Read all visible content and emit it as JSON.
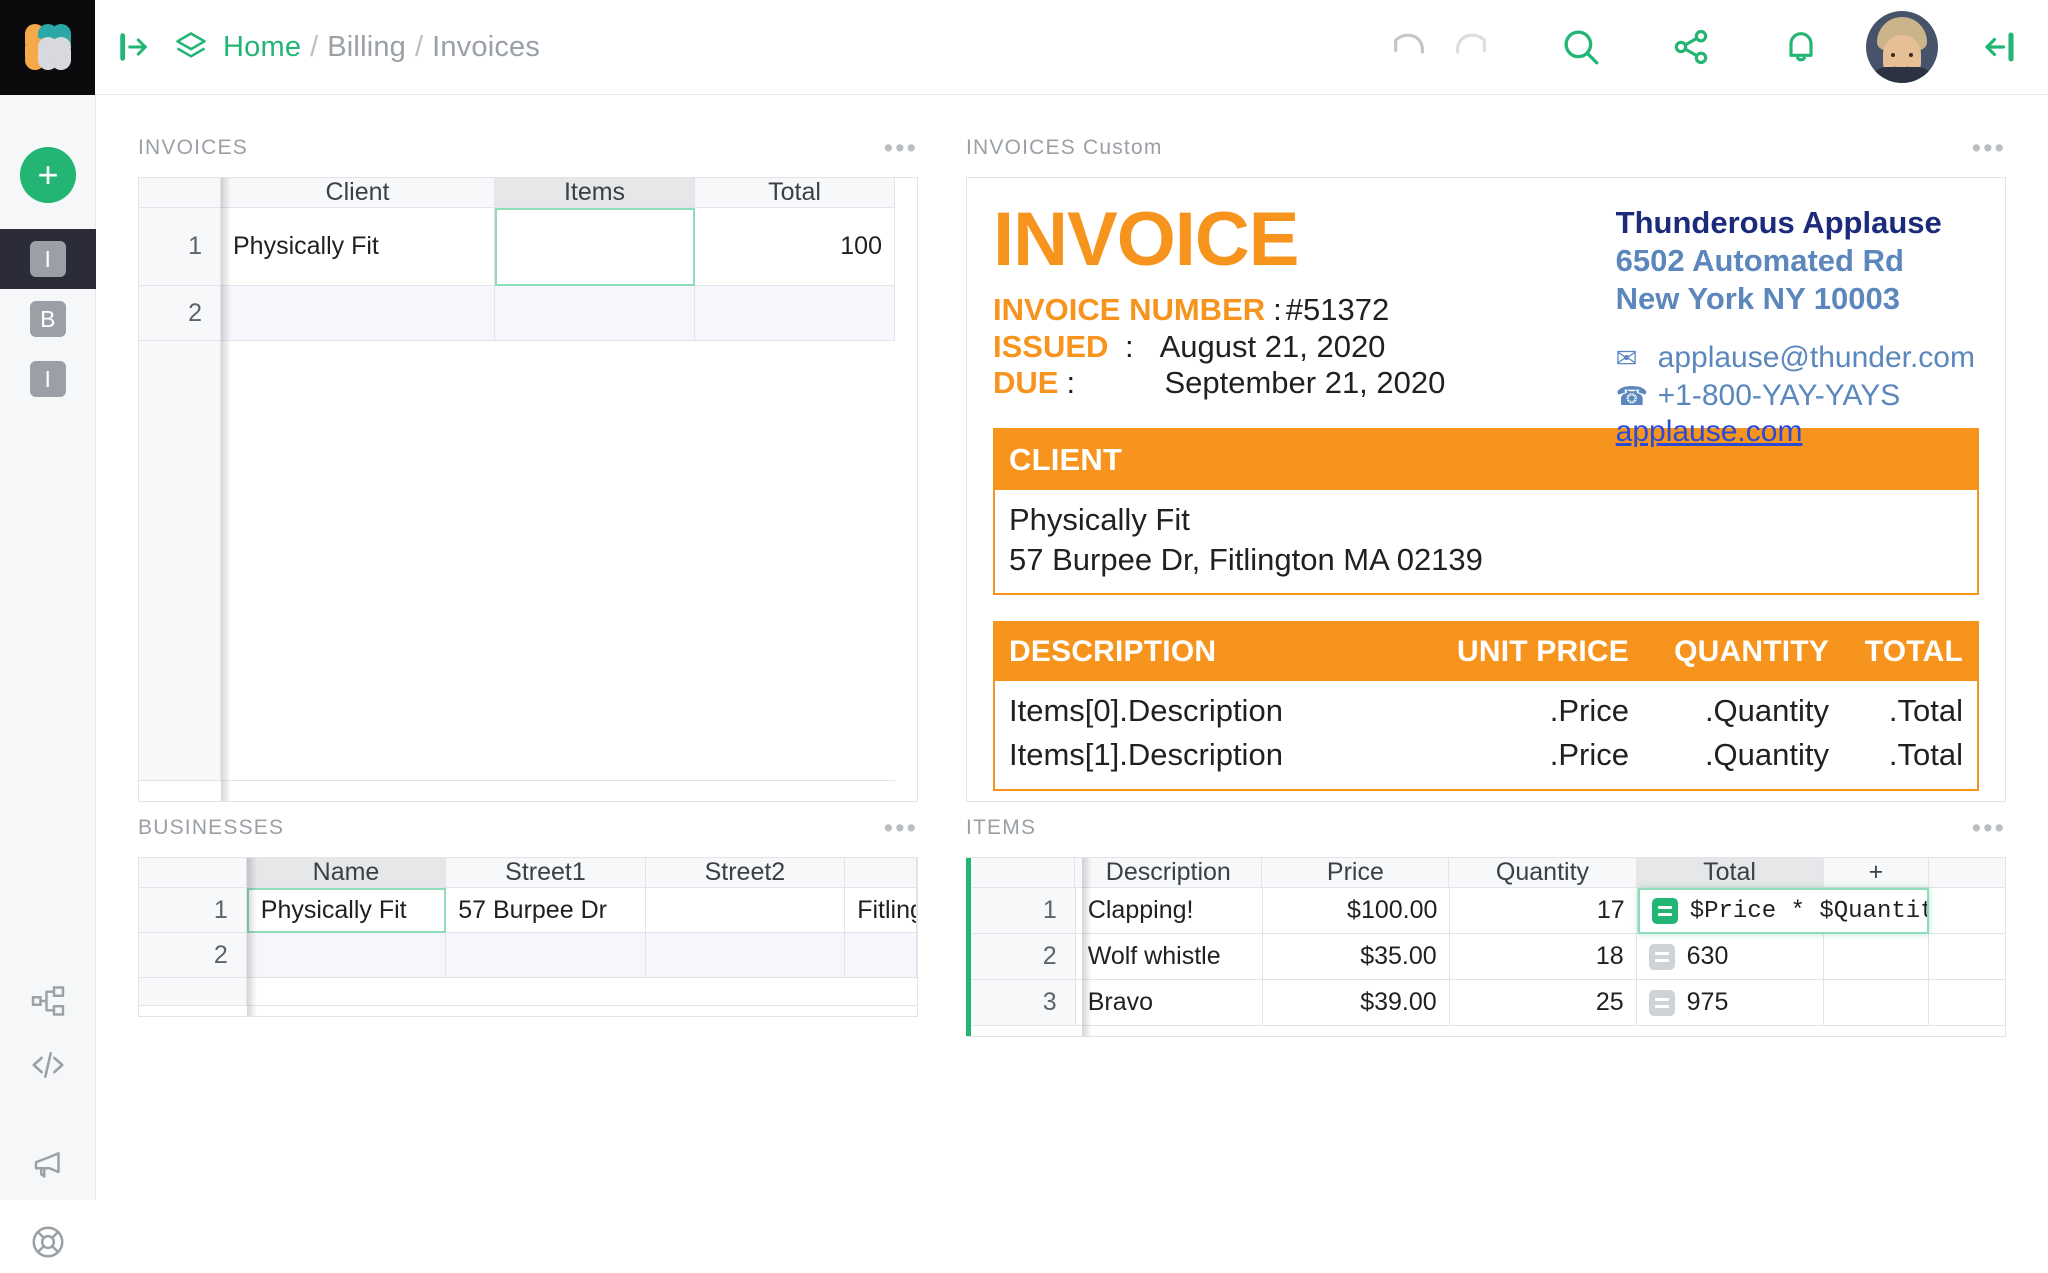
{
  "topbar": {
    "logo_colors": [
      "#2aa8a8",
      "#f5a94b",
      "#d7d9dc"
    ],
    "expand_icon": "enter-arrow-icon",
    "layers_icon": "layers-icon",
    "breadcrumb": [
      {
        "label": "Home",
        "active": true
      },
      {
        "label": "Billing",
        "active": false
      },
      {
        "label": "Invoices",
        "active": false
      }
    ],
    "separator": "/",
    "tools": [
      {
        "name": "undo-icon",
        "enabled": false
      },
      {
        "name": "redo-icon",
        "enabled": false
      },
      {
        "name": "search-icon",
        "enabled": true
      },
      {
        "name": "share-icon",
        "enabled": true
      },
      {
        "name": "notifications-bell-icon",
        "enabled": true
      }
    ],
    "avatar": "user-avatar",
    "collapse_icon": "collapse-left-icon",
    "accent": "#22b573"
  },
  "rail": {
    "add_label": "+",
    "apps": [
      {
        "label": "I",
        "active": true
      },
      {
        "label": "B",
        "active": false
      },
      {
        "label": "I",
        "active": false
      }
    ],
    "bottom_icons": [
      {
        "name": "schema-icon"
      },
      {
        "name": "code-icon"
      },
      {
        "name": "megaphone-icon"
      },
      {
        "name": "lifebuoy-help-icon"
      }
    ]
  },
  "panels": {
    "invoices": {
      "title": "INVOICES",
      "menu": "•••",
      "columns": [
        "",
        "Client",
        "Items",
        "Total"
      ],
      "selected_column": "Items",
      "rows": [
        {
          "n": "1",
          "Client": "Physically Fit",
          "Items": "",
          "Total": "100"
        },
        {
          "n": "2",
          "Client": "",
          "Items": "",
          "Total": ""
        }
      ],
      "selected_cell": {
        "row": 1,
        "column": "Items"
      }
    },
    "businesses": {
      "title": "BUSINESSES",
      "menu": "•••",
      "columns": [
        "",
        "Name",
        "Street1",
        "Street2",
        ""
      ],
      "selected_column": "Name",
      "rows": [
        {
          "n": "1",
          "Name": "Physically Fit",
          "Street1": "57 Burpee Dr",
          "Street2": "",
          "City": "Fitling"
        },
        {
          "n": "2",
          "Name": "",
          "Street1": "",
          "Street2": "",
          "City": ""
        }
      ],
      "selected_cell": {
        "row": 1,
        "column": "Name"
      }
    },
    "items": {
      "title": "ITEMS",
      "menu": "•••",
      "columns": [
        "",
        "Description",
        "Price",
        "Quantity",
        "Total",
        "+"
      ],
      "selected_column": "Total",
      "rows": [
        {
          "n": "1",
          "Description": "Clapping!",
          "Price": "$100.00",
          "Quantity": "17",
          "Total": "$Price * $Quantity",
          "formula_active": true
        },
        {
          "n": "2",
          "Description": "Wolf whistle",
          "Price": "$35.00",
          "Quantity": "18",
          "Total": "630",
          "formula_active": false
        },
        {
          "n": "3",
          "Description": "Bravo",
          "Price": "$39.00",
          "Quantity": "25",
          "Total": "975",
          "formula_active": false
        }
      ],
      "selected_cell": {
        "row": 1,
        "column": "Total"
      },
      "formula_icon": "formula-equals-icon"
    },
    "custom": {
      "title": "INVOICES Custom",
      "menu": "•••"
    }
  },
  "invoice": {
    "heading": "INVOICE",
    "accent": "#f7941e",
    "meta": [
      {
        "label": "INVOICE NUMBER",
        "colon": ":",
        "value": "#51372"
      },
      {
        "label": "ISSUED",
        "colon": ":",
        "value": "August 21, 2020"
      },
      {
        "label": "DUE",
        "colon": ":",
        "value": "September 21, 2020"
      }
    ],
    "company": {
      "name": "Thunderous Applause",
      "street": "6502 Automated Rd",
      "city": "New York NY 10003",
      "email_icon": "✉",
      "email": "applause@thunder.com",
      "phone_icon": "☎",
      "phone": "+1-800-YAY-YAYS",
      "website": "applause.com"
    },
    "client_section": {
      "heading": "CLIENT",
      "name": "Physically Fit",
      "address": "57 Burpee Dr, Fitlington MA 02139"
    },
    "line_table": {
      "headers": [
        "DESCRIPTION",
        "UNIT PRICE",
        "QUANTITY",
        "TOTAL"
      ],
      "rows": [
        {
          "description": "Items[0].Description",
          "price": ".Price",
          "quantity": ".Quantity",
          "total": ".Total"
        },
        {
          "description": "Items[1].Description",
          "price": ".Price",
          "quantity": ".Quantity",
          "total": ".Total"
        }
      ]
    }
  }
}
